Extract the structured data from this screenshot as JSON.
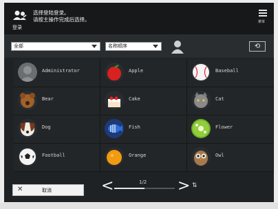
{
  "header": {
    "login_label": "登录",
    "message_line1": "选择登陆登录。",
    "message_line2": "请按主操作完成后选择。",
    "menu_caption": "菜单"
  },
  "filter": {
    "category_value": "全部",
    "sort_value": "名称顺序"
  },
  "users": [
    {
      "name": "Administrator",
      "icon": "administrator-avatar-icon"
    },
    {
      "name": "Apple",
      "icon": "apple-icon"
    },
    {
      "name": "Baseball",
      "icon": "baseball-icon"
    },
    {
      "name": "Bear",
      "icon": "bear-icon"
    },
    {
      "name": "Cake",
      "icon": "cake-icon"
    },
    {
      "name": "Cat",
      "icon": "cat-icon"
    },
    {
      "name": "Dog",
      "icon": "dog-icon"
    },
    {
      "name": "Fish",
      "icon": "fish-icon"
    },
    {
      "name": "Flower",
      "icon": "flower-icon"
    },
    {
      "name": "Football",
      "icon": "football-icon"
    },
    {
      "name": "Orange",
      "icon": "orange-icon"
    },
    {
      "name": "Owl",
      "icon": "owl-icon"
    }
  ],
  "footer": {
    "cancel_label": "取消",
    "page_indicator": "1/2",
    "page_progress": 0.5
  },
  "colors": {
    "panel_bg": "#1f2224",
    "cell_bg": "#232628",
    "text": "#d6d6d6"
  }
}
